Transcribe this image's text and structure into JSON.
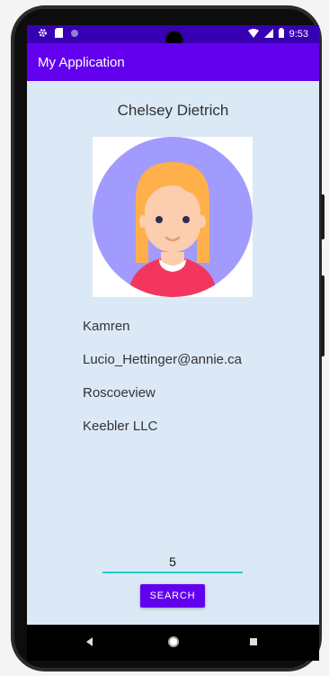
{
  "status_bar": {
    "time": "9:53",
    "icons_left": [
      "settings-icon",
      "sd-card-icon",
      "circle-icon"
    ],
    "icons_right": [
      "wifi-icon",
      "signal-icon",
      "battery-icon"
    ]
  },
  "app_bar": {
    "title": "My Application"
  },
  "profile": {
    "name": "Chelsey Dietrich",
    "username": "Kamren",
    "email": "Lucio_Hettinger@annie.ca",
    "city": "Roscoeview",
    "company": "Keebler LLC"
  },
  "search": {
    "value": "5",
    "button_label": "SEARCH"
  },
  "nav": {
    "back_icon": "back-icon",
    "home_icon": "home-icon",
    "recents_icon": "recents-icon"
  },
  "colors": {
    "status_bar": "#3700b3",
    "app_bar": "#6200ee",
    "screen_bg": "#dbe8f6",
    "accent_underline": "#18d0cc",
    "avatar_circle": "#a29bfe",
    "hair": "#ffb04a",
    "shirt": "#f2365d"
  }
}
